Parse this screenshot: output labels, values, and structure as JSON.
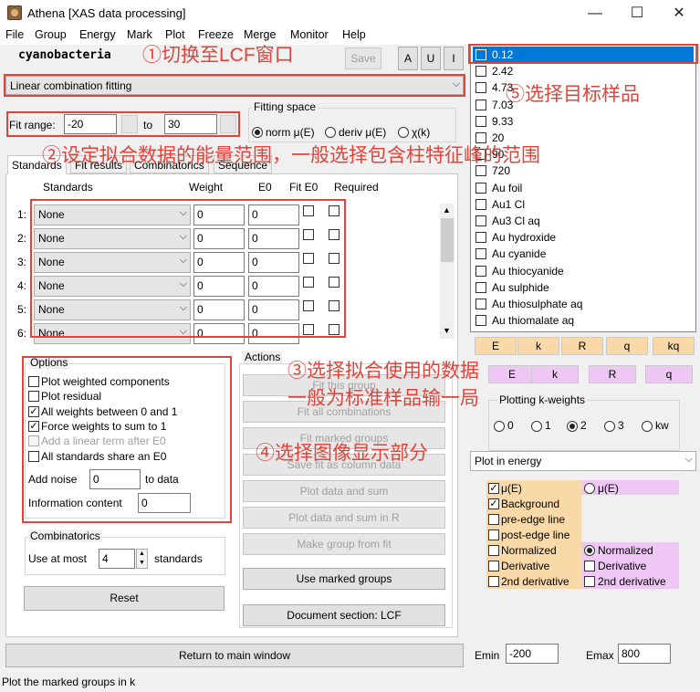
{
  "window": {
    "title": "Athena [XAS data processing]",
    "minimize": "—",
    "maximize": "☐",
    "close": "✕"
  },
  "menu": [
    "File",
    "Group",
    "Energy",
    "Mark",
    "Plot",
    "Freeze",
    "Merge",
    "Monitor",
    "Help"
  ],
  "header": {
    "group_name": "cyanobacteria",
    "save_label": "Save",
    "a_label": "A",
    "u_label": "U",
    "i_label": "I"
  },
  "mode_select": {
    "value": "Linear combination fitting"
  },
  "fit_range": {
    "label": "Fit range:",
    "from": "-20",
    "to_label": "to",
    "to": "30"
  },
  "fitting_space": {
    "title": "Fitting space",
    "options": [
      "norm μ(E)",
      "deriv μ(E)",
      "χ(k)"
    ],
    "selected": 0
  },
  "tabs": [
    "Standards",
    "Fit results",
    "Combinatorics",
    "Sequence"
  ],
  "standards_table": {
    "headers": {
      "standards": "Standards",
      "weight": "Weight",
      "e0": "E0",
      "fit_e0": "Fit E0",
      "required": "Required"
    },
    "rows": [
      {
        "index": "1:",
        "standard": "None",
        "weight": "0",
        "e0": "0"
      },
      {
        "index": "2:",
        "standard": "None",
        "weight": "0",
        "e0": "0"
      },
      {
        "index": "3:",
        "standard": "None",
        "weight": "0",
        "e0": "0"
      },
      {
        "index": "4:",
        "standard": "None",
        "weight": "0",
        "e0": "0"
      },
      {
        "index": "5:",
        "standard": "None",
        "weight": "0",
        "e0": "0"
      },
      {
        "index": "6:",
        "standard": "None",
        "weight": "0",
        "e0": "0"
      }
    ]
  },
  "options": {
    "title": "Options",
    "items": [
      {
        "label": "Plot weighted components",
        "checked": false,
        "enabled": true
      },
      {
        "label": "Plot residual",
        "checked": false,
        "enabled": true
      },
      {
        "label": "All weights between 0 and 1",
        "checked": true,
        "enabled": true
      },
      {
        "label": "Force weights to sum to 1",
        "checked": true,
        "enabled": true
      },
      {
        "label": "Add a linear term after E0",
        "checked": false,
        "enabled": false
      },
      {
        "label": "All standards share an E0",
        "checked": false,
        "enabled": true
      }
    ],
    "noise_label": "Add noise",
    "noise_value": "0",
    "noise_suffix": "to data",
    "info_label": "Information content",
    "info_value": "0"
  },
  "combinatorics": {
    "title": "Combinatorics",
    "use_label": "Use at most",
    "value": "4",
    "suffix": "standards"
  },
  "reset_label": "Reset",
  "actions": {
    "title": "Actions",
    "buttons": [
      {
        "label": "Fit this group",
        "enabled": false
      },
      {
        "label": "Fit all combinations",
        "enabled": false
      },
      {
        "label": "Fit marked groups",
        "enabled": false
      },
      {
        "label": "Save fit as column data",
        "enabled": false
      },
      {
        "label": "Plot data and sum",
        "enabled": false
      },
      {
        "label": "Plot data and sum in R",
        "enabled": false
      },
      {
        "label": "Make group from fit",
        "enabled": false
      },
      {
        "label": "Use marked groups",
        "enabled": true
      },
      {
        "label": "Document section: LCF",
        "enabled": true
      }
    ]
  },
  "return_label": "Return to main window",
  "status": "Plot the marked groups in k",
  "groups": [
    {
      "label": "0.12",
      "selected": true
    },
    {
      "label": "2.42",
      "selected": false
    },
    {
      "label": "4.73",
      "selected": false
    },
    {
      "label": "7.03",
      "selected": false
    },
    {
      "label": "9.33",
      "selected": false
    },
    {
      "label": "20",
      "selected": false
    },
    {
      "label": "90",
      "selected": false
    },
    {
      "label": "720",
      "selected": false
    },
    {
      "label": "Au foil",
      "selected": false
    },
    {
      "label": "Au1 Cl",
      "selected": false
    },
    {
      "label": "Au3 Cl aq",
      "selected": false
    },
    {
      "label": "Au hydroxide",
      "selected": false
    },
    {
      "label": "Au cyanide",
      "selected": false
    },
    {
      "label": "Au thiocyanide",
      "selected": false
    },
    {
      "label": "Au sulphide",
      "selected": false
    },
    {
      "label": "Au thiosulphate aq",
      "selected": false
    },
    {
      "label": "Au thiomalate aq",
      "selected": false
    }
  ],
  "plot_buttons_row1": [
    "E",
    "k",
    "R",
    "q",
    "kq"
  ],
  "plot_buttons_row2": [
    "E",
    "k",
    "R",
    "q"
  ],
  "kweights": {
    "title": "Plotting k-weights",
    "options": [
      "0",
      "1",
      "2",
      "3",
      "kw"
    ],
    "selected": 2
  },
  "plot_select": {
    "value": "Plot in energy"
  },
  "plot_options_left": [
    {
      "label": "μ(E)",
      "checked": true
    },
    {
      "label": "Background",
      "checked": true
    },
    {
      "label": "pre-edge line",
      "checked": false
    },
    {
      "label": "post-edge line",
      "checked": false
    },
    {
      "label": "Normalized",
      "checked": false
    },
    {
      "label": "Derivative",
      "checked": false
    },
    {
      "label": "2nd derivative",
      "checked": false
    }
  ],
  "plot_options_right": [
    {
      "label": "μ(E)",
      "type": "radio",
      "checked": false
    },
    {
      "label": "Normalized",
      "type": "radio",
      "checked": true
    },
    {
      "label": "Derivative",
      "type": "check",
      "checked": false
    },
    {
      "label": "2nd derivative",
      "type": "check",
      "checked": false
    }
  ],
  "emin": {
    "label": "Emin",
    "value": "-200"
  },
  "emax": {
    "label": "Emax",
    "value": "800"
  },
  "annotations": {
    "a1": "①切换至LCF窗口",
    "a2": "②设定拟合数据的能量范围，一般选择包含柱特征峰的范围",
    "a3_line1": "③选择拟合使用的数据",
    "a3_line2": "一般为标准样品输一局",
    "a4": "④选择图像显示部分",
    "a5": "⑤选择目标样品"
  },
  "colors": {
    "annotation": "#e0443a",
    "selection": "#0078d7",
    "orange": "#f9d9a8",
    "pink": "#efc7f5"
  }
}
